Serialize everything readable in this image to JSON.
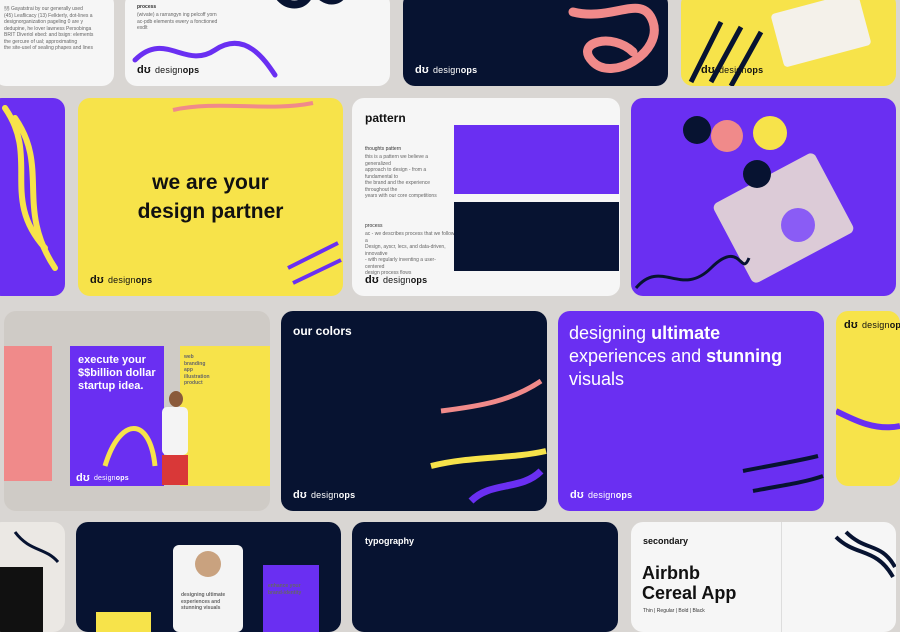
{
  "brand": {
    "name_regular": "design",
    "name_bold": "ops",
    "mark": "dʊ"
  },
  "colors": {
    "yellow": "#f7e34a",
    "purple": "#6a2ff2",
    "navy": "#071331",
    "pink": "#f08a8a",
    "white": "#f6f6f6"
  },
  "top_row": {
    "card1_lines": [
      "§§ Gayatstrai by our generally used",
      "(45) Leaflicacy (13) Felkterly, dot-lines a",
      "designorganization pageling 0 are y",
      "dedupine, he lover lawness Persobinga",
      "BRIT Diveriol ebed: and bsign:  elements",
      "the gercure of ual; approximating",
      "the site-usel of sealing phapes and lines"
    ],
    "card2_label": "process",
    "card2_lines": [
      "(wivate) a rarrangyn ing pelcoff yorn",
      "ac-pdb elements ewery a fonctioned exdlt"
    ]
  },
  "partner_card": {
    "line1": "we are your",
    "line2": "design partner"
  },
  "pattern_card": {
    "title": "pattern",
    "sub1": "thoughts pattern",
    "sub1_lines": [
      "this is a pattern we believe a generalized",
      "approach to design - from a fundamental to",
      "the brand and the experience throughout the",
      "years with our core competitions"
    ],
    "sub2": "process",
    "sub2_lines": [
      "ac - we describes process that we follow a",
      "Design, ayscr, lecs, and data-driven, innovative",
      "- with regularly inventing a user-centered",
      "design process flows"
    ]
  },
  "poster_card": {
    "poster1_line1": "execute your",
    "poster1_line2": "$$billion dollar",
    "poster1_line3": "startup idea.",
    "poster2_items": [
      "web",
      "branding",
      "app",
      "illustration",
      "product"
    ]
  },
  "colors_card": {
    "title": "our colors"
  },
  "ultimate_card": {
    "w1": "designing",
    "w2": "ultimate",
    "w3": "experiences and",
    "w4": "stunning",
    "w5": "visuals"
  },
  "bottom_row": {
    "phone_text": [
      "designing ultimate",
      "experiences and",
      "stunning visuals"
    ],
    "poster_text": [
      "enhance your",
      "brand-identity"
    ],
    "typography_title": "typography",
    "secondary_label": "secondary",
    "font_name_line1": "Airbnb",
    "font_name_line2": "Cereal App",
    "font_weights": "Thin | Regular | Bold | Black"
  }
}
